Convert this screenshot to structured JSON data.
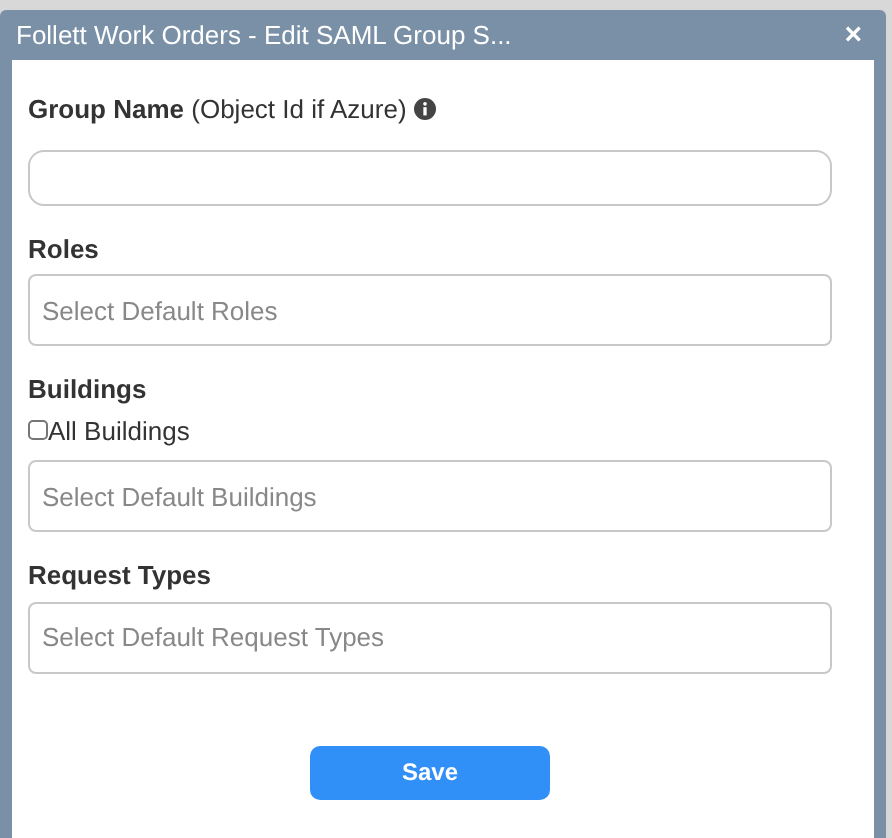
{
  "window": {
    "title": "Follett Work Orders - Edit SAML Group S...",
    "close": "×"
  },
  "group_name": {
    "label": "Group Name",
    "hint": "(Object Id if Azure)"
  },
  "roles": {
    "label": "Roles",
    "placeholder": "Select Default Roles"
  },
  "buildings": {
    "label": "Buildings",
    "all_label": "All Buildings",
    "all_checked": false,
    "placeholder": "Select Default Buildings"
  },
  "request_types": {
    "label": "Request Types",
    "placeholder": "Select Default Request Types"
  },
  "save_button": "Save"
}
